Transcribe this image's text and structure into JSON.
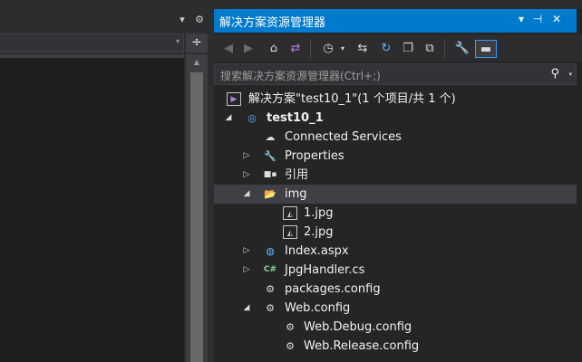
{
  "left_panel": {
    "dropdown_glyph": "▾",
    "gear_glyph": "⚙",
    "split_glyph": "÷",
    "scroll_up_glyph": "▲",
    "combo_arrow_glyph": "▾"
  },
  "solution_explorer": {
    "title": "解决方案资源管理器",
    "title_controls": {
      "dropdown": "▾",
      "pin": "⊣",
      "close": "✕"
    },
    "toolbar": {
      "back": "◀",
      "forward": "▶",
      "home": "⌂",
      "vs_switch": "⇄",
      "history": "◷",
      "history_drop": "▾",
      "sync": "⇆",
      "refresh": "↻",
      "collapse_all": "❐",
      "show_all_files": "⧉",
      "properties": "🔧",
      "preview": "▬"
    },
    "search": {
      "placeholder": "搜索解决方案资源管理器(Ctrl+;)",
      "icon": "⚲",
      "dropdown": "▾"
    },
    "tree": [
      {
        "label": "解决方案\"test10_1\"(1 个项目/共 1 个)",
        "icon": "solution-icon",
        "glyph": "▶"
      },
      {
        "label": "test10_1",
        "icon": "web-project-icon",
        "glyph": "◎",
        "expander": "◢"
      },
      {
        "label": "Connected Services",
        "icon": "cloud-icon",
        "glyph": "☁"
      },
      {
        "label": "Properties",
        "icon": "wrench-icon",
        "glyph": "🔧",
        "expander": "▷"
      },
      {
        "label": "引用",
        "icon": "references-icon",
        "glyph": "■▪",
        "expander": "▷"
      },
      {
        "label": "img",
        "icon": "folder-icon",
        "glyph": "📂",
        "expander": "◢"
      },
      {
        "label": "1.jpg",
        "icon": "image-file-icon",
        "glyph": "◭"
      },
      {
        "label": "2.jpg",
        "icon": "image-file-icon",
        "glyph": "◭"
      },
      {
        "label": "Index.aspx",
        "icon": "aspx-file-icon",
        "glyph": "◍",
        "expander": "▷"
      },
      {
        "label": "JpgHandler.cs",
        "icon": "csharp-file-icon",
        "glyph": "C#",
        "expander": "▷"
      },
      {
        "label": "packages.config",
        "icon": "config-file-icon",
        "glyph": "⚙"
      },
      {
        "label": "Web.config",
        "icon": "config-file-icon",
        "glyph": "⚙",
        "expander": "◢"
      },
      {
        "label": "Web.Debug.config",
        "icon": "config-file-icon",
        "glyph": "⚙"
      },
      {
        "label": "Web.Release.config",
        "icon": "config-file-icon",
        "glyph": "⚙"
      }
    ],
    "colors": {
      "title_bar": "#007acc",
      "tree_background": "#252526",
      "selection": "#3f3f46"
    }
  }
}
